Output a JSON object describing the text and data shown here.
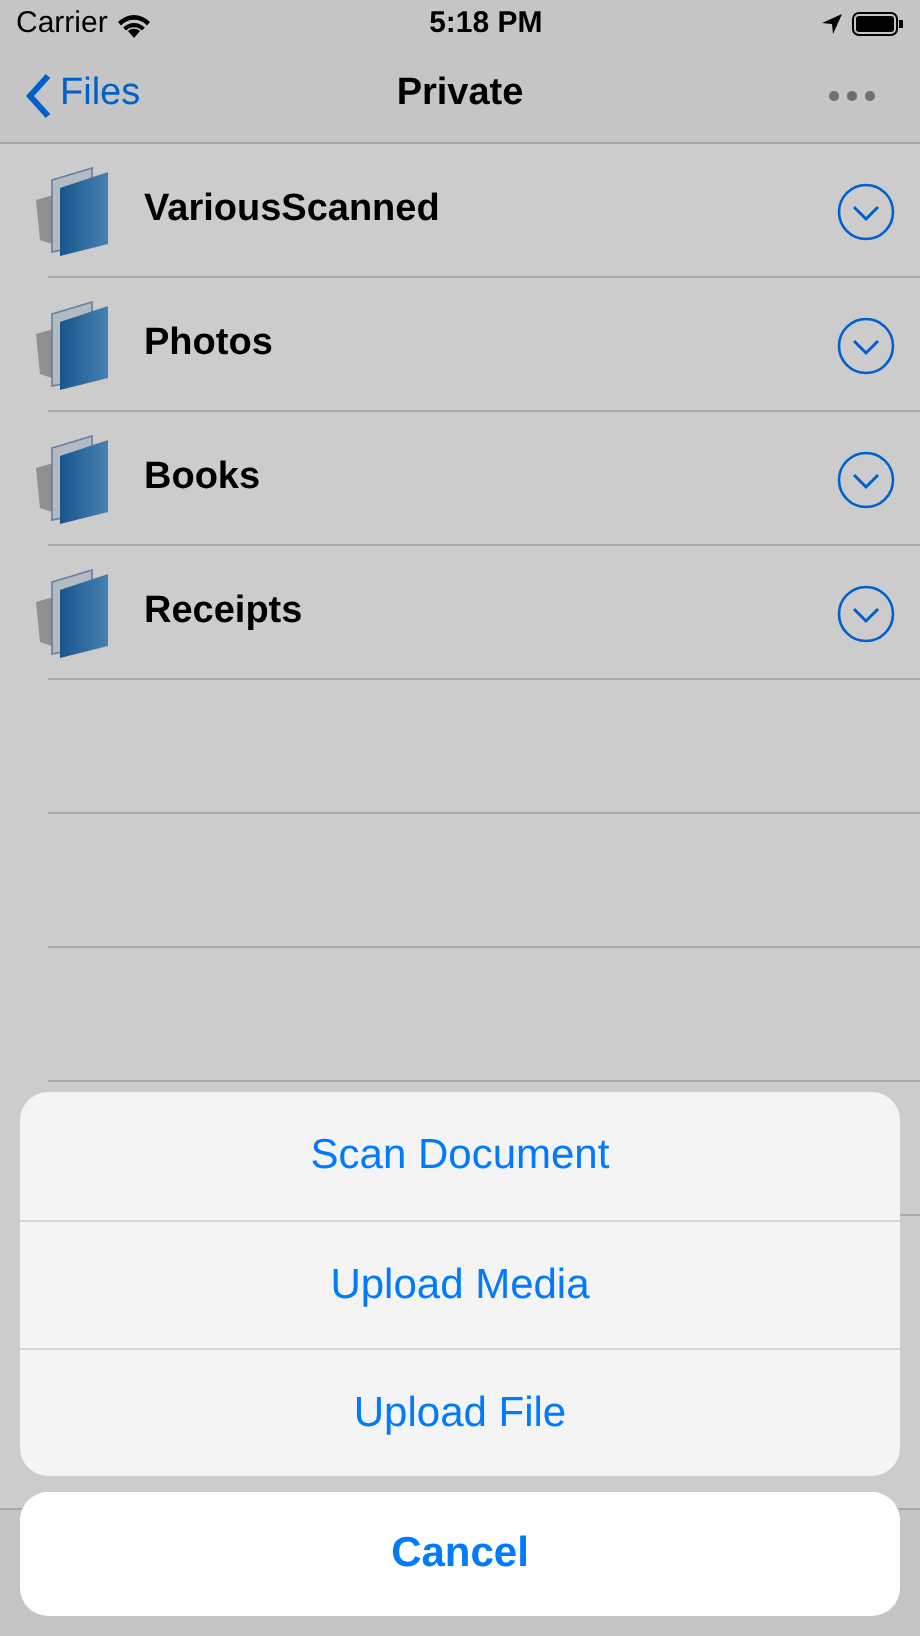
{
  "status_bar": {
    "carrier": "Carrier",
    "time": "5:18 PM"
  },
  "nav_bar": {
    "back": "Files",
    "title": "Private"
  },
  "folders": [
    {
      "name": "VariousScanned"
    },
    {
      "name": "Photos"
    },
    {
      "name": "Books"
    },
    {
      "name": "Receipts"
    }
  ],
  "action_sheet": {
    "actions": [
      "Scan Document",
      "Upload Media",
      "Upload File"
    ],
    "cancel": "Cancel"
  }
}
